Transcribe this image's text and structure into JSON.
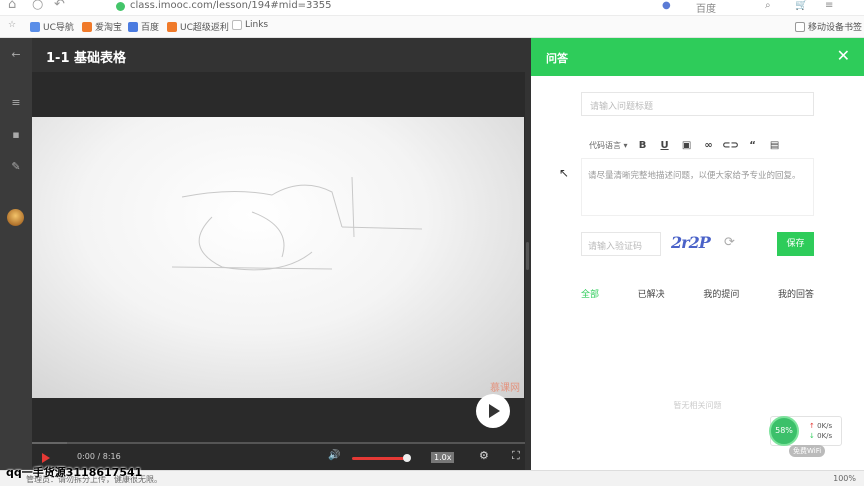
{
  "browser": {
    "url": "class.imooc.com/lesson/194#mid=3355",
    "search_label": "百度",
    "bookmarks": [
      "UC导航",
      "爱淘宝",
      "百度",
      "UC超级返利",
      "Links"
    ],
    "mobile_bookmarks": "移动设备书签"
  },
  "lesson": {
    "title": "1-1 基础表格"
  },
  "video": {
    "time": "0:00 / 8:16",
    "speed": "1.0x",
    "watermark": "慕课网",
    "progress_fraction": 0.07,
    "volume_fraction": 1.0
  },
  "overlay": {
    "qq_text": "qq一手货源3118617541"
  },
  "statusbar": {
    "tip": "管理员：请勿拆分上传，健康很无限。",
    "zoom": "100%"
  },
  "qa_panel": {
    "title": "问答",
    "title_placeholder": "请输入问题标题",
    "toolbar_lang": "代码语言",
    "editor_placeholder": "请尽量清晰完整地描述问题，以便大家给予专业的回复。",
    "captcha_placeholder": "请输入验证码",
    "captcha_text": "2r2P",
    "save_label": "保存",
    "tabs": [
      "全部",
      "已解决",
      "我的提问",
      "我的回答"
    ],
    "empty_text": "暂无相关问题"
  },
  "speed_widget": {
    "percent": "58%",
    "up": "0K/s",
    "down": "0K/s",
    "wifi": "免费WiFi"
  },
  "colors": {
    "accent_green": "#2ecc5a",
    "player_red": "#e53935",
    "dark_bg": "#2a2a2a"
  }
}
